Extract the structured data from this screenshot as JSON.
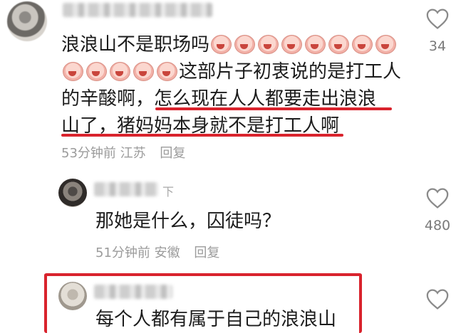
{
  "comments": [
    {
      "text_line1_a": "浪浪山不是职场吗",
      "emoji_count_1": 8,
      "emoji_count_2": 5,
      "text_line2_b": "这部片子初衷说的是打工人",
      "text_line3": "的辛酸啊，怎么现在人人都要走出浪浪",
      "text_line4": "山了，猪妈妈本身就不是打工人啊",
      "time": "53分钟前",
      "location": "江苏",
      "reply_label": "回复",
      "likes": "34",
      "highlight_color": "#d9232d"
    },
    {
      "name_suffix": "下",
      "text": "那她是什么，囚徒吗？",
      "time": "51分钟前",
      "location": "安徽",
      "reply_label": "回复",
      "likes": "480"
    },
    {
      "text_partial": "每个人都有属于自己的浪浪山"
    }
  ],
  "icons": {
    "like": "heart-outline-icon",
    "emoji": "crying-face-emoji-icon"
  }
}
